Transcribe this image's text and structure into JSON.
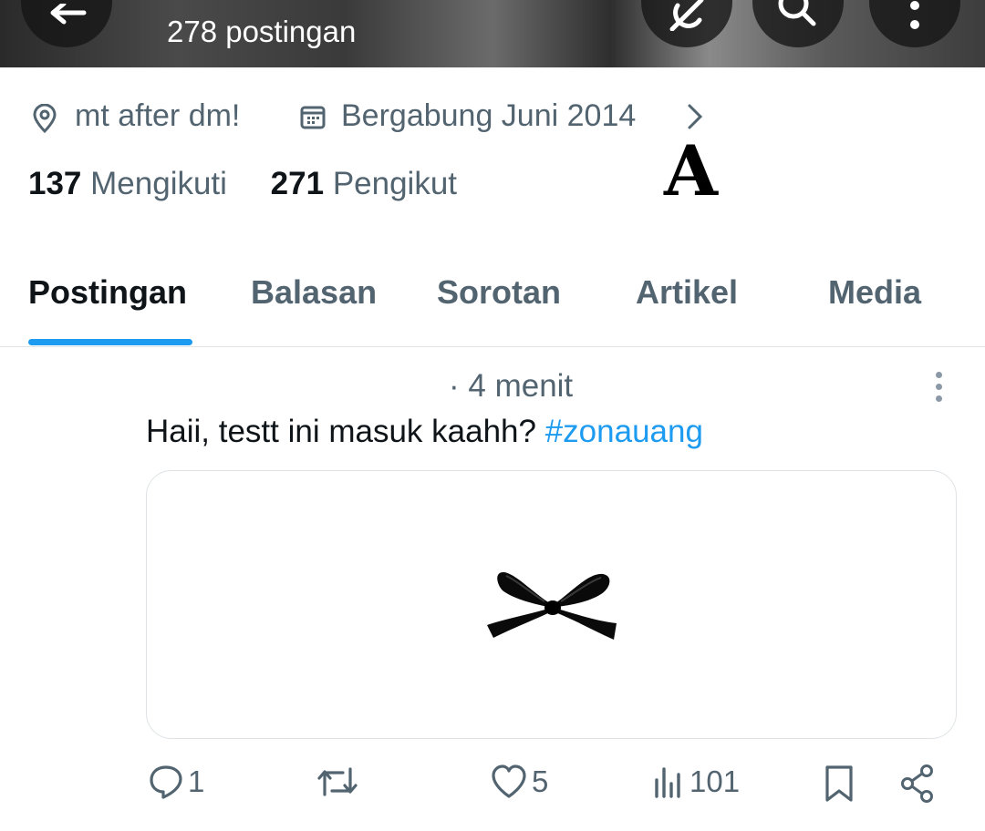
{
  "header": {
    "post_count": "278 postingan",
    "icons": [
      "back-arrow-icon",
      "grok-icon",
      "search-icon",
      "more-vertical-icon"
    ]
  },
  "profile": {
    "location": "mt after dm!",
    "joined": "Bergabung Juni 2014",
    "following_count": "137",
    "following_label": "Mengikuti",
    "followers_count": "271",
    "followers_label": "Pengikut"
  },
  "overlay_letter": "A",
  "tabs": [
    {
      "label": "Postingan",
      "active": true
    },
    {
      "label": "Balasan"
    },
    {
      "label": "Sorotan"
    },
    {
      "label": "Artikel"
    },
    {
      "label": "Media"
    }
  ],
  "post": {
    "time": "· 4 menit",
    "text": "Haii, testt ini masuk kaahh? ",
    "hashtag": "#zonauang",
    "image_icon": "black-bow-icon",
    "actions": {
      "replies": "1",
      "reposts": "",
      "likes": "5",
      "views": "101"
    }
  },
  "colors": {
    "accent": "#1d9bf0",
    "secondary_text": "#536471",
    "primary_text": "#0f1419"
  }
}
